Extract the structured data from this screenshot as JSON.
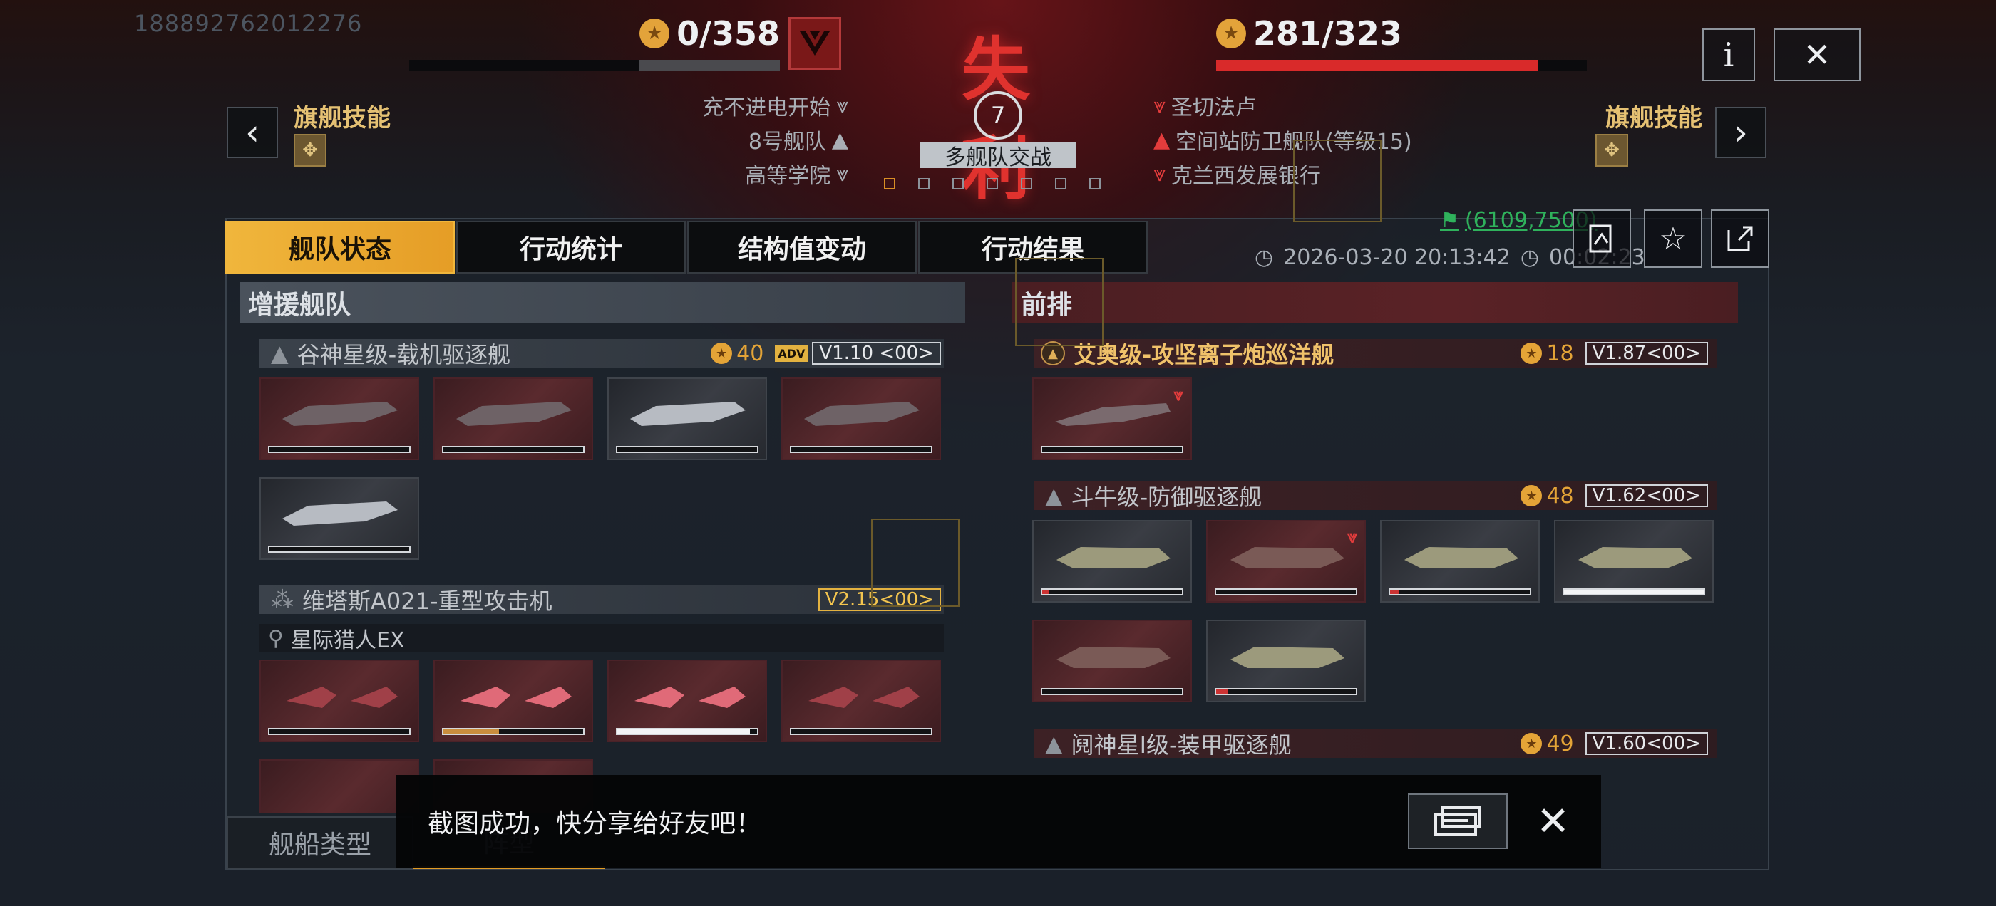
{
  "user_id": "188892762012276",
  "result": {
    "title": "失利",
    "left_score": "0/358",
    "left_progress": 0.38,
    "right_score": "281/323",
    "right_progress": 0.87,
    "battle_type": "多舰队交战",
    "center_badge": "7"
  },
  "nav": {
    "left_skill_label": "旗舰技能",
    "right_skill_label": "旗舰技能",
    "prev_icon": "chevron-left-icon",
    "next_icon": "chevron-right-icon"
  },
  "left_objectives": [
    "充不进电开始",
    "8号舰队",
    "高等学院"
  ],
  "right_objectives": [
    "圣切法卢",
    "空间站防卫舰队(等级15)",
    "克兰西发展银行"
  ],
  "top_buttons": {
    "info": "i",
    "close": "✕"
  },
  "tabs": [
    "舰队状态",
    "行动统计",
    "结构值变动",
    "行动结果"
  ],
  "meta": {
    "coordinates": "(6109,7500)",
    "datetime": "2026-03-20 20:13:42",
    "duration": "00:02:23"
  },
  "left_section": {
    "title": "增援舰队",
    "fleets": [
      {
        "name": "谷神星级-载机驱逐舰",
        "cost": "40",
        "badge": "ADV",
        "version": "V1.10 <00>",
        "ships": [
          {
            "hp": 0
          },
          {
            "hp": 0
          },
          {
            "hp": 0
          },
          {
            "hp": 0
          },
          {
            "hp": 0
          }
        ]
      },
      {
        "name": "维塔斯A021-重型攻击机",
        "cost": "",
        "version": "V2.15<00>",
        "sub": "星际猎人EX",
        "ships": [
          {
            "hp": 0
          },
          {
            "hp": 0.4
          },
          {
            "hp": 0.95
          },
          {
            "hp": 0
          }
        ]
      }
    ]
  },
  "right_section": {
    "title": "前排",
    "fleets": [
      {
        "name": "艾奥级-攻坚离子炮巡洋舰",
        "cost": "18",
        "version": "V1.87<00>",
        "ships": [
          {
            "hp": 0
          }
        ]
      },
      {
        "name": "斗牛级-防御驱逐舰",
        "cost": "48",
        "version": "V1.62<00>",
        "ships": [
          {
            "hp": 0.05
          },
          {
            "hp": 0
          },
          {
            "hp": 0.06
          },
          {
            "hp": 1.0
          },
          {
            "hp": 0
          },
          {
            "hp": 0.08
          }
        ]
      },
      {
        "name": "阋神星I级-装甲驱逐舰",
        "cost": "49",
        "version": "V1.60<00>"
      }
    ]
  },
  "toast": {
    "message": "截图成功，快分享给好友吧！"
  },
  "bottom_tabs": [
    "舰船类型",
    "阵型"
  ]
}
